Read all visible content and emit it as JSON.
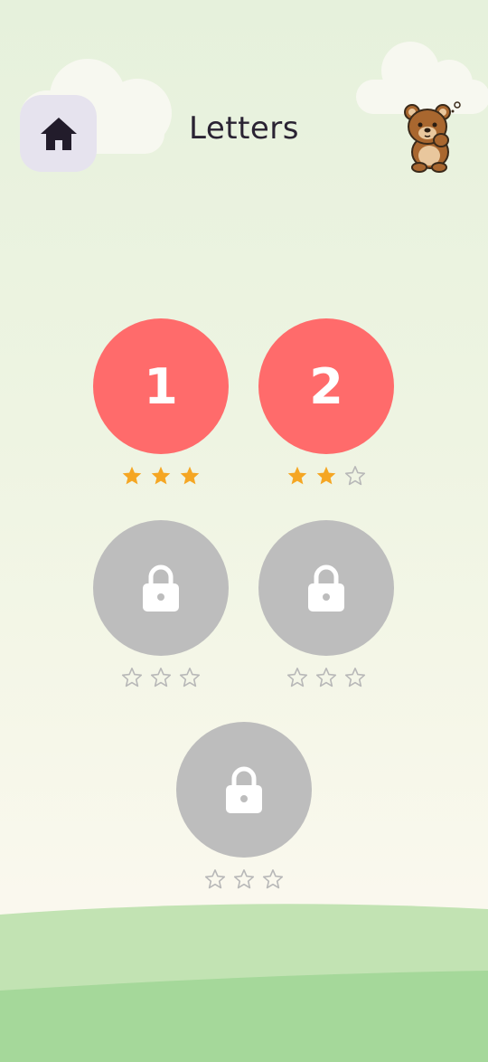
{
  "header": {
    "title": "Letters",
    "home_icon": "home-icon",
    "mascot_icon": "bear-mascot-icon"
  },
  "levels": [
    {
      "label": "1",
      "locked": false,
      "stars_earned": 3,
      "stars_total": 3
    },
    {
      "label": "2",
      "locked": false,
      "stars_earned": 2,
      "stars_total": 3
    },
    {
      "label": "",
      "locked": true,
      "stars_earned": 0,
      "stars_total": 3
    },
    {
      "label": "",
      "locked": true,
      "stars_earned": 0,
      "stars_total": 3
    },
    {
      "label": "",
      "locked": true,
      "stars_earned": 0,
      "stars_total": 3
    }
  ],
  "colors": {
    "level_open": "#ff6b6b",
    "level_locked": "#bdbdbd",
    "star_filled": "#f5a623",
    "star_empty_outline": "#b8b8b8",
    "hill_light": "#c2e3b3",
    "hill_dark": "#a5d89a"
  }
}
